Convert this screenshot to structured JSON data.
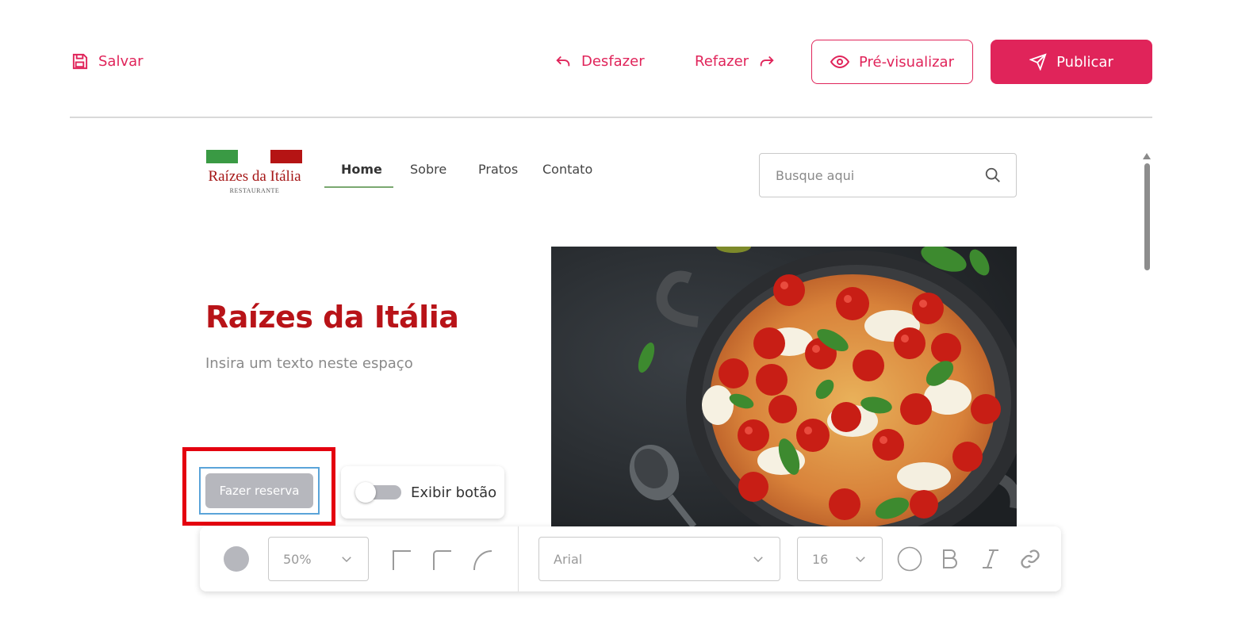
{
  "toolbar": {
    "save_label": "Salvar",
    "undo_label": "Desfazer",
    "redo_label": "Refazer",
    "preview_label": "Pré-visualizar",
    "publish_label": "Publicar"
  },
  "site": {
    "logo": {
      "name": "Raízes da Itália",
      "subtitle": "RESTAURANTE"
    },
    "nav": [
      "Home",
      "Sobre",
      "Pratos",
      "Contato"
    ],
    "search_placeholder": "Busque aqui",
    "hero": {
      "title": "Raízes da Itália",
      "subtitle": "Insira um texto neste espaço",
      "cta_label": "Fazer reserva",
      "toggle_label": "Exibir botão"
    }
  },
  "format_bar": {
    "opacity": "50%",
    "font": "Arial",
    "font_size": "16"
  },
  "colors": {
    "accent": "#e0245a",
    "brand_red": "#b81318",
    "highlight": "#e4000f",
    "selection": "#5aa4d9"
  }
}
